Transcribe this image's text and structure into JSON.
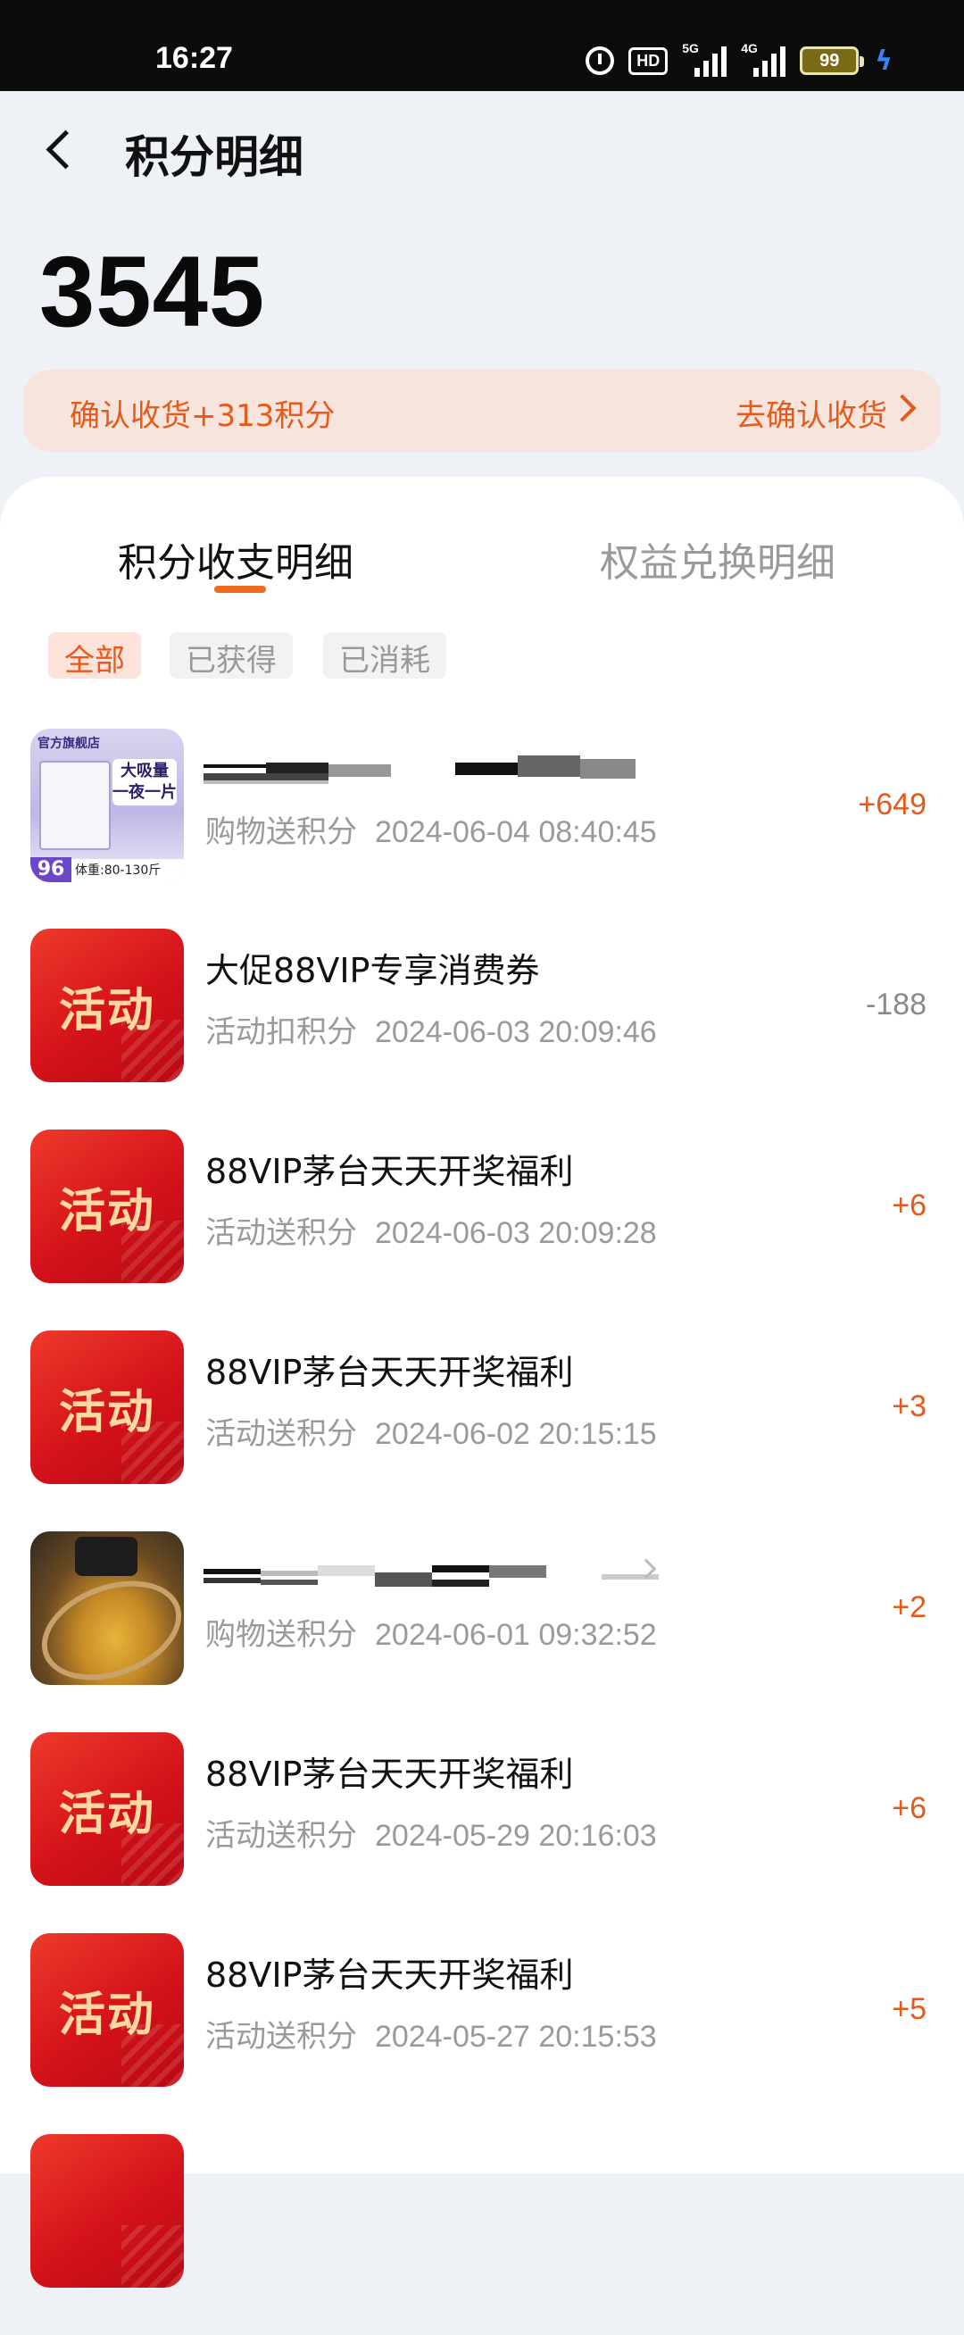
{
  "status_bar": {
    "time": "16:27",
    "hd_label": "HD",
    "sim1_label": "5G",
    "sim2_label": "4G",
    "battery": "99",
    "icons": [
      "alarm-icon",
      "hd-icon",
      "signal-5g-icon",
      "signal-4g-icon",
      "battery-icon",
      "charging-icon"
    ]
  },
  "header": {
    "title": "积分明细",
    "back_icon": "chevron-left-icon"
  },
  "points_total": "3545",
  "confirm_banner": {
    "text": "确认收货+313积分",
    "action": "去确认收货"
  },
  "tabs": [
    {
      "label": "积分收支明细",
      "active": true
    },
    {
      "label": "权益兑换明细",
      "active": false
    }
  ],
  "filters": [
    {
      "label": "全部",
      "active": true
    },
    {
      "label": "已获得",
      "active": false
    },
    {
      "label": "已消耗",
      "active": false
    }
  ],
  "records": [
    {
      "thumb": "product",
      "title": "",
      "type": "购物送积分",
      "time": "2024-06-04 08:40:45",
      "amount": "+649",
      "product_thumb": {
        "store": "官方旗舰店",
        "headline": "大吸量 一夜一片",
        "count": "96",
        "weight": "体重:80-130斤"
      }
    },
    {
      "thumb": "activity",
      "thumb_text": "活动",
      "title": "大促88VIP专享消费券",
      "type": "活动扣积分",
      "time": "2024-06-03 20:09:46",
      "amount": "-188"
    },
    {
      "thumb": "activity",
      "thumb_text": "活动",
      "title": "88VIP茅台天天开奖福利",
      "type": "活动送积分",
      "time": "2024-06-03 20:09:28",
      "amount": "+6"
    },
    {
      "thumb": "activity",
      "thumb_text": "活动",
      "title": "88VIP茅台天天开奖福利",
      "type": "活动送积分",
      "time": "2024-06-02 20:15:15",
      "amount": "+3"
    },
    {
      "thumb": "product",
      "title": "",
      "type": "购物送积分",
      "time": "2024-06-01 09:32:52",
      "amount": "+2"
    },
    {
      "thumb": "activity",
      "thumb_text": "活动",
      "title": "88VIP茅台天天开奖福利",
      "type": "活动送积分",
      "time": "2024-05-29 20:16:03",
      "amount": "+6"
    },
    {
      "thumb": "activity",
      "thumb_text": "活动",
      "title": "88VIP茅台天天开奖福利",
      "type": "活动送积分",
      "time": "2024-05-27 20:15:53",
      "amount": "+5"
    }
  ]
}
